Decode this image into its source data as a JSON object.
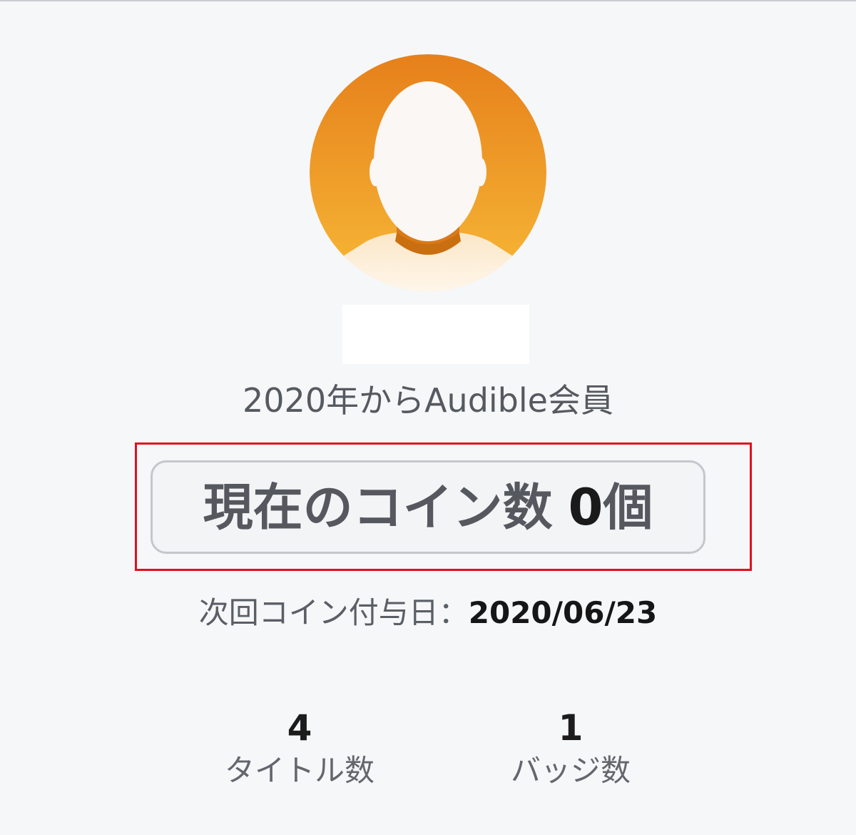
{
  "profile": {
    "avatar_icon": "person-silhouette-icon",
    "member_since": "2020年からAudible会員"
  },
  "coins": {
    "label": "現在のコイン数",
    "count": "0",
    "unit": "個"
  },
  "next_coin": {
    "label": "次回コイン付与日：",
    "date": "2020/06/23"
  },
  "stats": {
    "titles": {
      "value": "4",
      "label": "タイトル数"
    },
    "badges": {
      "value": "1",
      "label": "バッジ数"
    }
  },
  "colors": {
    "avatar_gradient_top": "#e8831a",
    "avatar_gradient_bottom": "#f6b535",
    "highlight_border": "#e3101e",
    "background": "#f6f7f9"
  }
}
